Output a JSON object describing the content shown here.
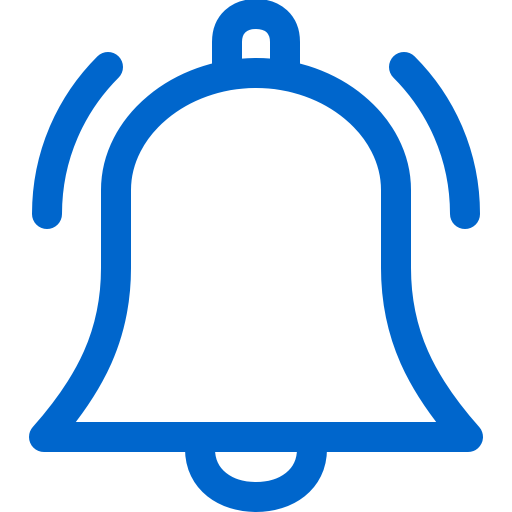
{
  "icon": {
    "name": "bell-notification-icon",
    "color": "#0066cc",
    "background": "#ffffff"
  }
}
